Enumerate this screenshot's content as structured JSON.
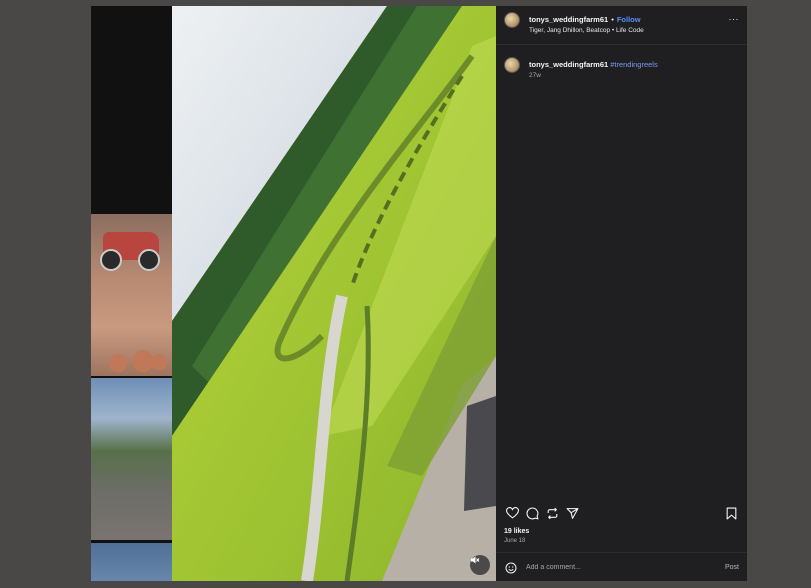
{
  "post": {
    "username": "tonys_weddingfarm61",
    "follow_label": "Follow",
    "separator": "•",
    "audio": "Tiger, Jang Dhillon, Beatcop • Life Code",
    "more_label": "···"
  },
  "caption": {
    "username": "tonys_weddingfarm61",
    "hashtag": "#trendingreels",
    "age": "27w"
  },
  "stats": {
    "likes": "19 likes",
    "date": "June 18"
  },
  "comment": {
    "placeholder": "Add a comment...",
    "post_label": "Post"
  },
  "icons": {
    "like": "heart-icon",
    "comment": "comment-icon",
    "share": "repost-icon",
    "send": "send-icon",
    "save": "bookmark-icon",
    "emoji": "emoji-icon",
    "mute": "mute-icon"
  },
  "colors": {
    "accent": "#5b8df6",
    "hashtag": "#7c9cf0",
    "panel_bg": "#1f1f22"
  }
}
